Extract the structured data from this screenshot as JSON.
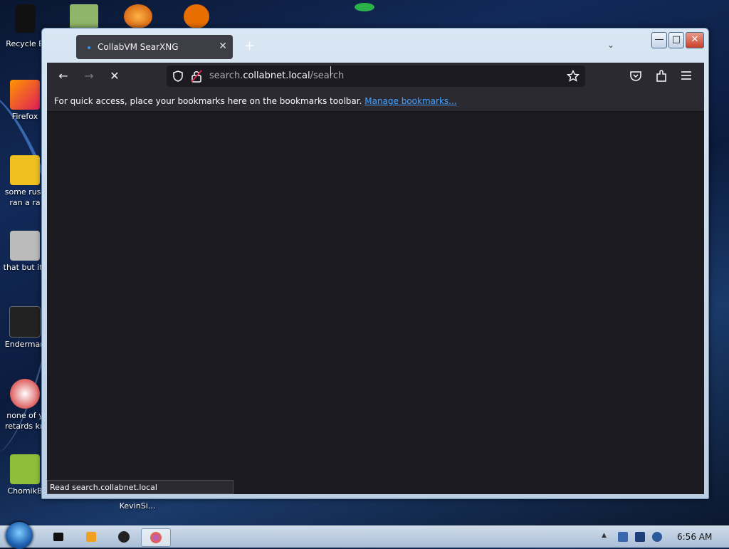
{
  "desktop": {
    "icons": [
      {
        "label1": "Recycle B",
        "label2": ""
      },
      {
        "label1": "Firefox",
        "label2": ""
      },
      {
        "label1": "some russ",
        "label2": "ran a ra"
      },
      {
        "label1": "that but its",
        "label2": ""
      },
      {
        "label1": "Enderman",
        "label2": ""
      },
      {
        "label1": "none of y",
        "label2": "retards kn"
      },
      {
        "label1": "ChomikB",
        "label2": ""
      }
    ],
    "kevin_label": "KevinSi..."
  },
  "browser": {
    "tab": {
      "title": "CollabVM SearXNG",
      "close": "✕"
    },
    "new_tab": "+",
    "list_tabs": "⌄",
    "window_controls": {
      "minimize": "—",
      "maximize": "□",
      "close": "✕"
    },
    "nav": {
      "back": "←",
      "forward": "→",
      "stop": "✕"
    },
    "url": {
      "domain_prefix": "search.",
      "domain": "collabnet.local",
      "path": "/search"
    },
    "bookmarks_bar": {
      "text": "For quick access, place your bookmarks here on the bookmarks toolbar.",
      "link": "Manage bookmarks..."
    },
    "status_text": "Read search.collabnet.local"
  },
  "taskbar": {
    "clock": "6:56 AM"
  },
  "colors": {
    "browser_dark": "#2b2a33",
    "content_bg": "#1c1b22",
    "link": "#45a1ff"
  }
}
